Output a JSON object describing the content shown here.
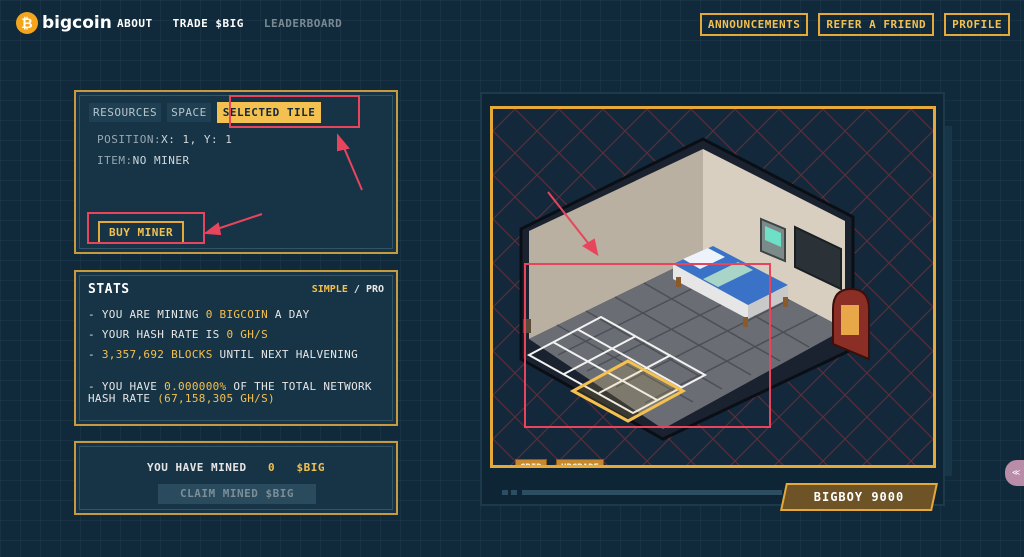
{
  "header": {
    "logo_text": "bigcoin",
    "nav": [
      {
        "label": "ABOUT",
        "active": true
      },
      {
        "label": "TRADE $BIG",
        "active": true
      },
      {
        "label": "LEADERBOARD",
        "active": false
      }
    ],
    "right_buttons": [
      "ANNOUNCEMENTS",
      "REFER A FRIEND",
      "PROFILE"
    ]
  },
  "tile_panel": {
    "tabs": [
      "RESOURCES",
      "SPACE",
      "SELECTED TILE"
    ],
    "active_tab": "SELECTED TILE",
    "position_label": "POSITION:",
    "position_value": "X: 1, Y: 1",
    "item_label": "ITEM:",
    "item_value": "NO MINER",
    "buy_button": "BUY MINER"
  },
  "stats": {
    "title": "STATS",
    "mode_simple": "SIMPLE",
    "mode_sep": "/",
    "mode_pro": "PRO",
    "line1_pre": "- YOU ARE MINING ",
    "line1_val": "0 BIGCOIN",
    "line1_post": " A DAY",
    "line2_pre": "- YOUR HASH RATE IS ",
    "line2_val": "0 GH/S",
    "line3_pre": "- ",
    "line3_val": "3,357,692 BLOCKS",
    "line3_post": " UNTIL NEXT HALVENING",
    "line4_pre": "- YOU HAVE ",
    "line4_val": "0.000000%",
    "line4_mid": " OF THE TOTAL NETWORK HASH RATE ",
    "line4_val2": "(67,158,305 GH/S)"
  },
  "mined": {
    "label": "YOU HAVE MINED",
    "amount": "0",
    "unit": "$BIG",
    "claim_button": "CLAIM MINED $BIG"
  },
  "game": {
    "grid_button": "GRID",
    "upgrade_button": "UPGRADE",
    "name_plate": "BIGBOY 9000",
    "selected_tile": {
      "x": 1,
      "y": 1
    }
  },
  "side_tab": "≪"
}
